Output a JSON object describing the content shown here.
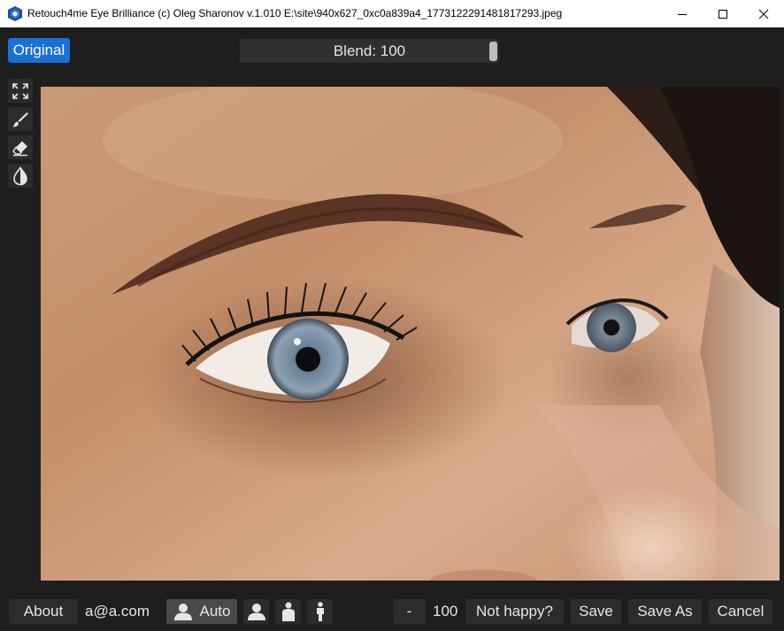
{
  "window": {
    "title": "Retouch4me Eye Brilliance (c) Oleg Sharonov v.1.010 E:\\site\\940x627_0xc0a839a4_1773122291481817293.jpeg",
    "controls": [
      "minimize-icon",
      "maximize-icon",
      "close-icon"
    ]
  },
  "toolbar": {
    "original_label": "Original",
    "blend_label": "Blend: 100",
    "blend_value": 100,
    "tools": [
      "fit-screen-icon",
      "brush-icon",
      "eraser-icon",
      "contrast-icon"
    ]
  },
  "footer": {
    "about_label": "About",
    "account": "a@a.com",
    "auto_label": "Auto",
    "mode_icons": [
      "portrait-head-icon",
      "portrait-half-body-icon",
      "portrait-full-body-icon"
    ],
    "minus_label": "-",
    "amount_value": "100",
    "not_happy_label": "Not happy?",
    "save_label": "Save",
    "save_as_label": "Save As",
    "cancel_label": "Cancel"
  },
  "colors": {
    "accent": "#1a6fd9",
    "background": "#1e1e1e",
    "button": "#2c2c2c",
    "active_mode": "#4a4a4a"
  }
}
